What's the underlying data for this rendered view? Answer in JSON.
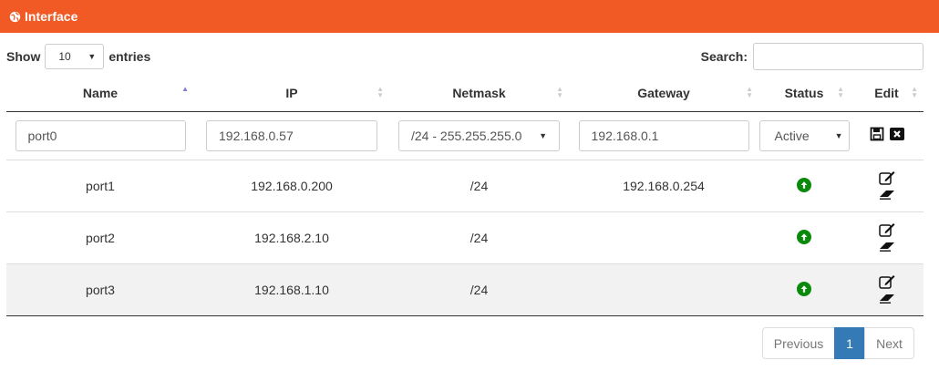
{
  "panel": {
    "title": "Interface",
    "icon": "globe-icon",
    "header_color": "#f15a24"
  },
  "toolbar": {
    "show_label": "Show",
    "entries_value": "10",
    "entries_label": "entries",
    "search_label": "Search:",
    "search_value": ""
  },
  "columns": [
    {
      "label": "Name",
      "sort": "asc"
    },
    {
      "label": "IP",
      "sort": "none"
    },
    {
      "label": "Netmask",
      "sort": "none"
    },
    {
      "label": "Gateway",
      "sort": "none"
    },
    {
      "label": "Status",
      "sort": "none"
    },
    {
      "label": "Edit",
      "sort": "none"
    }
  ],
  "edit_row": {
    "name": "port0",
    "ip": "192.168.0.57",
    "netmask": "/24 - 255.255.255.0",
    "gateway": "192.168.0.1",
    "status": "Active",
    "save_icon": "save-icon",
    "cancel_icon": "close-icon"
  },
  "rows": [
    {
      "name": "port1",
      "ip": "192.168.0.200",
      "netmask": "/24",
      "gateway": "192.168.0.254",
      "status_icon": "status-up-icon"
    },
    {
      "name": "port2",
      "ip": "192.168.2.10",
      "netmask": "/24",
      "gateway": "",
      "status_icon": "status-up-icon"
    },
    {
      "name": "port3",
      "ip": "192.168.1.10",
      "netmask": "/24",
      "gateway": "",
      "status_icon": "status-up-icon"
    }
  ],
  "pagination": {
    "previous": "Previous",
    "current": "1",
    "next": "Next",
    "active_color": "#337ab7"
  }
}
